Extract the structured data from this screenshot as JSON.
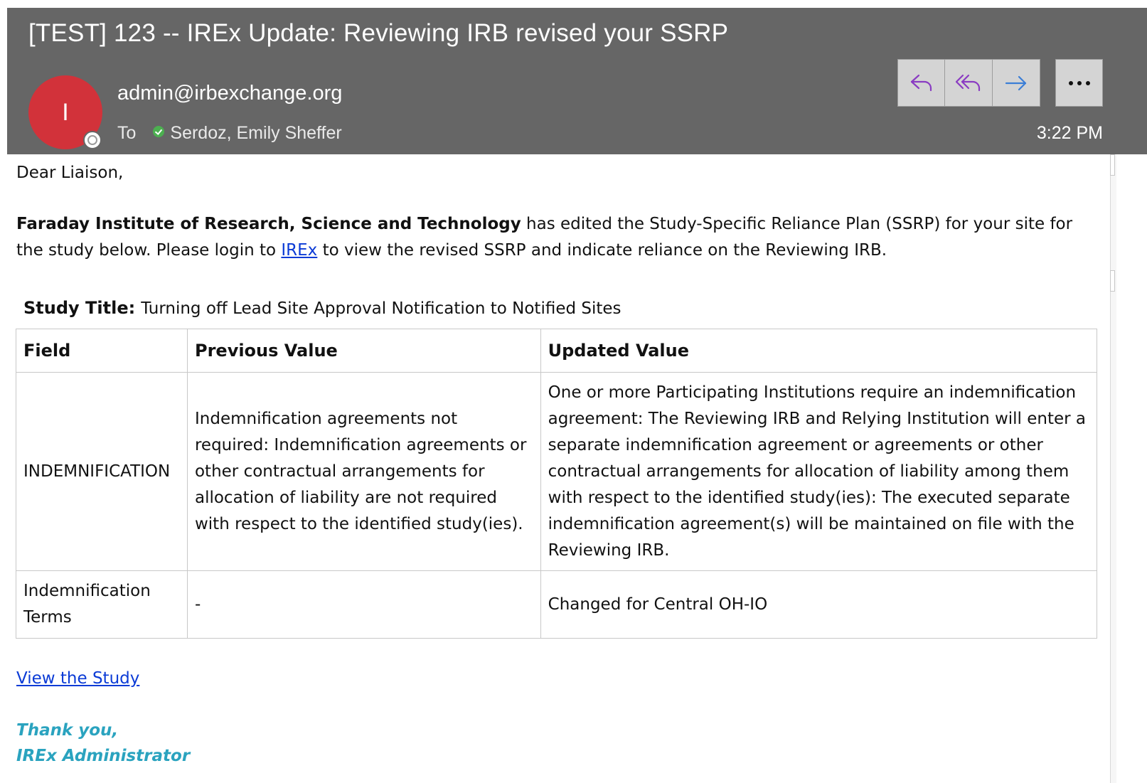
{
  "email": {
    "subject": "[TEST] 123 -- IREx Update: Reviewing IRB revised your SSRP",
    "avatar_initial": "I",
    "sender": "admin@irbexchange.org",
    "to_label": "To",
    "recipient": "Serdoz, Emily Sheffer",
    "time": "3:22 PM",
    "actions": {
      "reply_icon": "reply-icon",
      "reply_all_icon": "reply-all-icon",
      "forward_icon": "forward-icon",
      "more_label": "···"
    },
    "accent_color": "#8a3cc2",
    "forward_color": "#3b7ed6"
  },
  "body": {
    "greeting": "Dear Liaison,",
    "institution": "Faraday Institute of Research, Science and Technology",
    "para_part1": " has edited the Study-Specific Reliance Plan (SSRP) for your site for the study below. Please login to ",
    "irex_link": "IREx",
    "para_part2": " to view the revised SSRP and indicate reliance on the Reviewing IRB.",
    "study_title_label": "Study Title:",
    "study_title": "Turning off Lead Site Approval Notification to Notified Sites",
    "table": {
      "headers": [
        "Field",
        "Previous Value",
        "Updated Value"
      ],
      "rows": [
        {
          "field": "INDEMNIFICATION",
          "previous": "Indemnification agreements not required: Indemnification agreements or other contractual arrangements for allocation of liability are not required with respect to the identified study(ies).",
          "updated": "One or more Participating Institutions require an indemnification agreement: The Reviewing IRB and Relying Institution will enter a separate indemnification agreement or agreements or other contractual arrangements for allocation of liability among them with respect to the identified study(ies): The executed separate indemnification agreement(s) will be maintained on file with the Reviewing IRB."
        },
        {
          "field": "Indemnification Terms",
          "previous": "-",
          "updated": "Changed for Central OH-IO"
        }
      ]
    },
    "view_study_link": "View the Study",
    "signoff_1": "Thank you,",
    "signoff_2": "IREx Administrator"
  }
}
